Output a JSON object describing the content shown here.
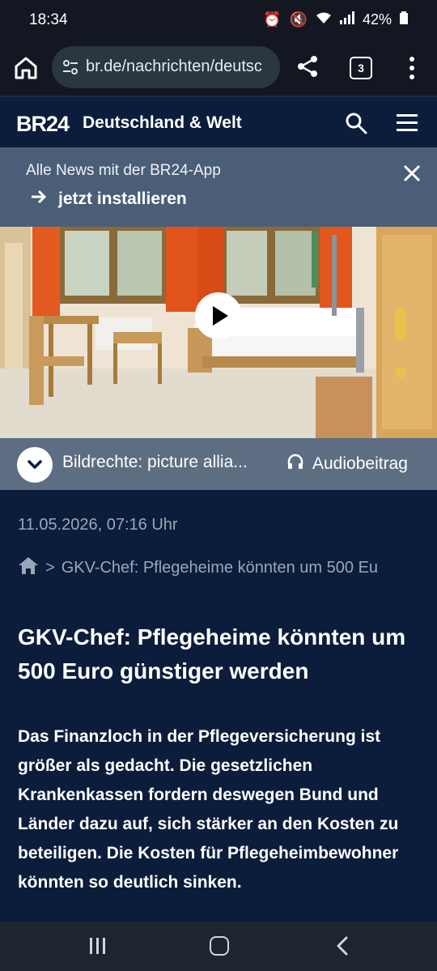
{
  "status": {
    "time": "18:34",
    "battery": "42%"
  },
  "browser": {
    "url": "br.de/nachrichten/deutsc",
    "tab_count": "3"
  },
  "site": {
    "logo": "BR24",
    "section": "Deutschland & Welt"
  },
  "banner": {
    "text": "Alle News mit der BR24-App",
    "cta": "jetzt installieren"
  },
  "media": {
    "caption": "Bildrechte: picture allia...",
    "audio_label": "Audiobeitrag"
  },
  "article": {
    "date": "11.05.2026, 07:16 Uhr",
    "breadcrumb": "GKV-Chef: Pflegeheime könnten um 500 Eu",
    "headline": "GKV-Chef: Pflegeheime könnten um 500 Euro günstiger werden",
    "teaser": "Das Finanzloch in der Pflegeversicherung ist größer als gedacht. Die gesetzlichen Krankenkassen fordern deswegen Bund und Länder dazu auf, sich stärker an den Kosten zu beteiligen. Die Kosten für Pflegeheimbewohner könnten so deutlich sinken."
  }
}
